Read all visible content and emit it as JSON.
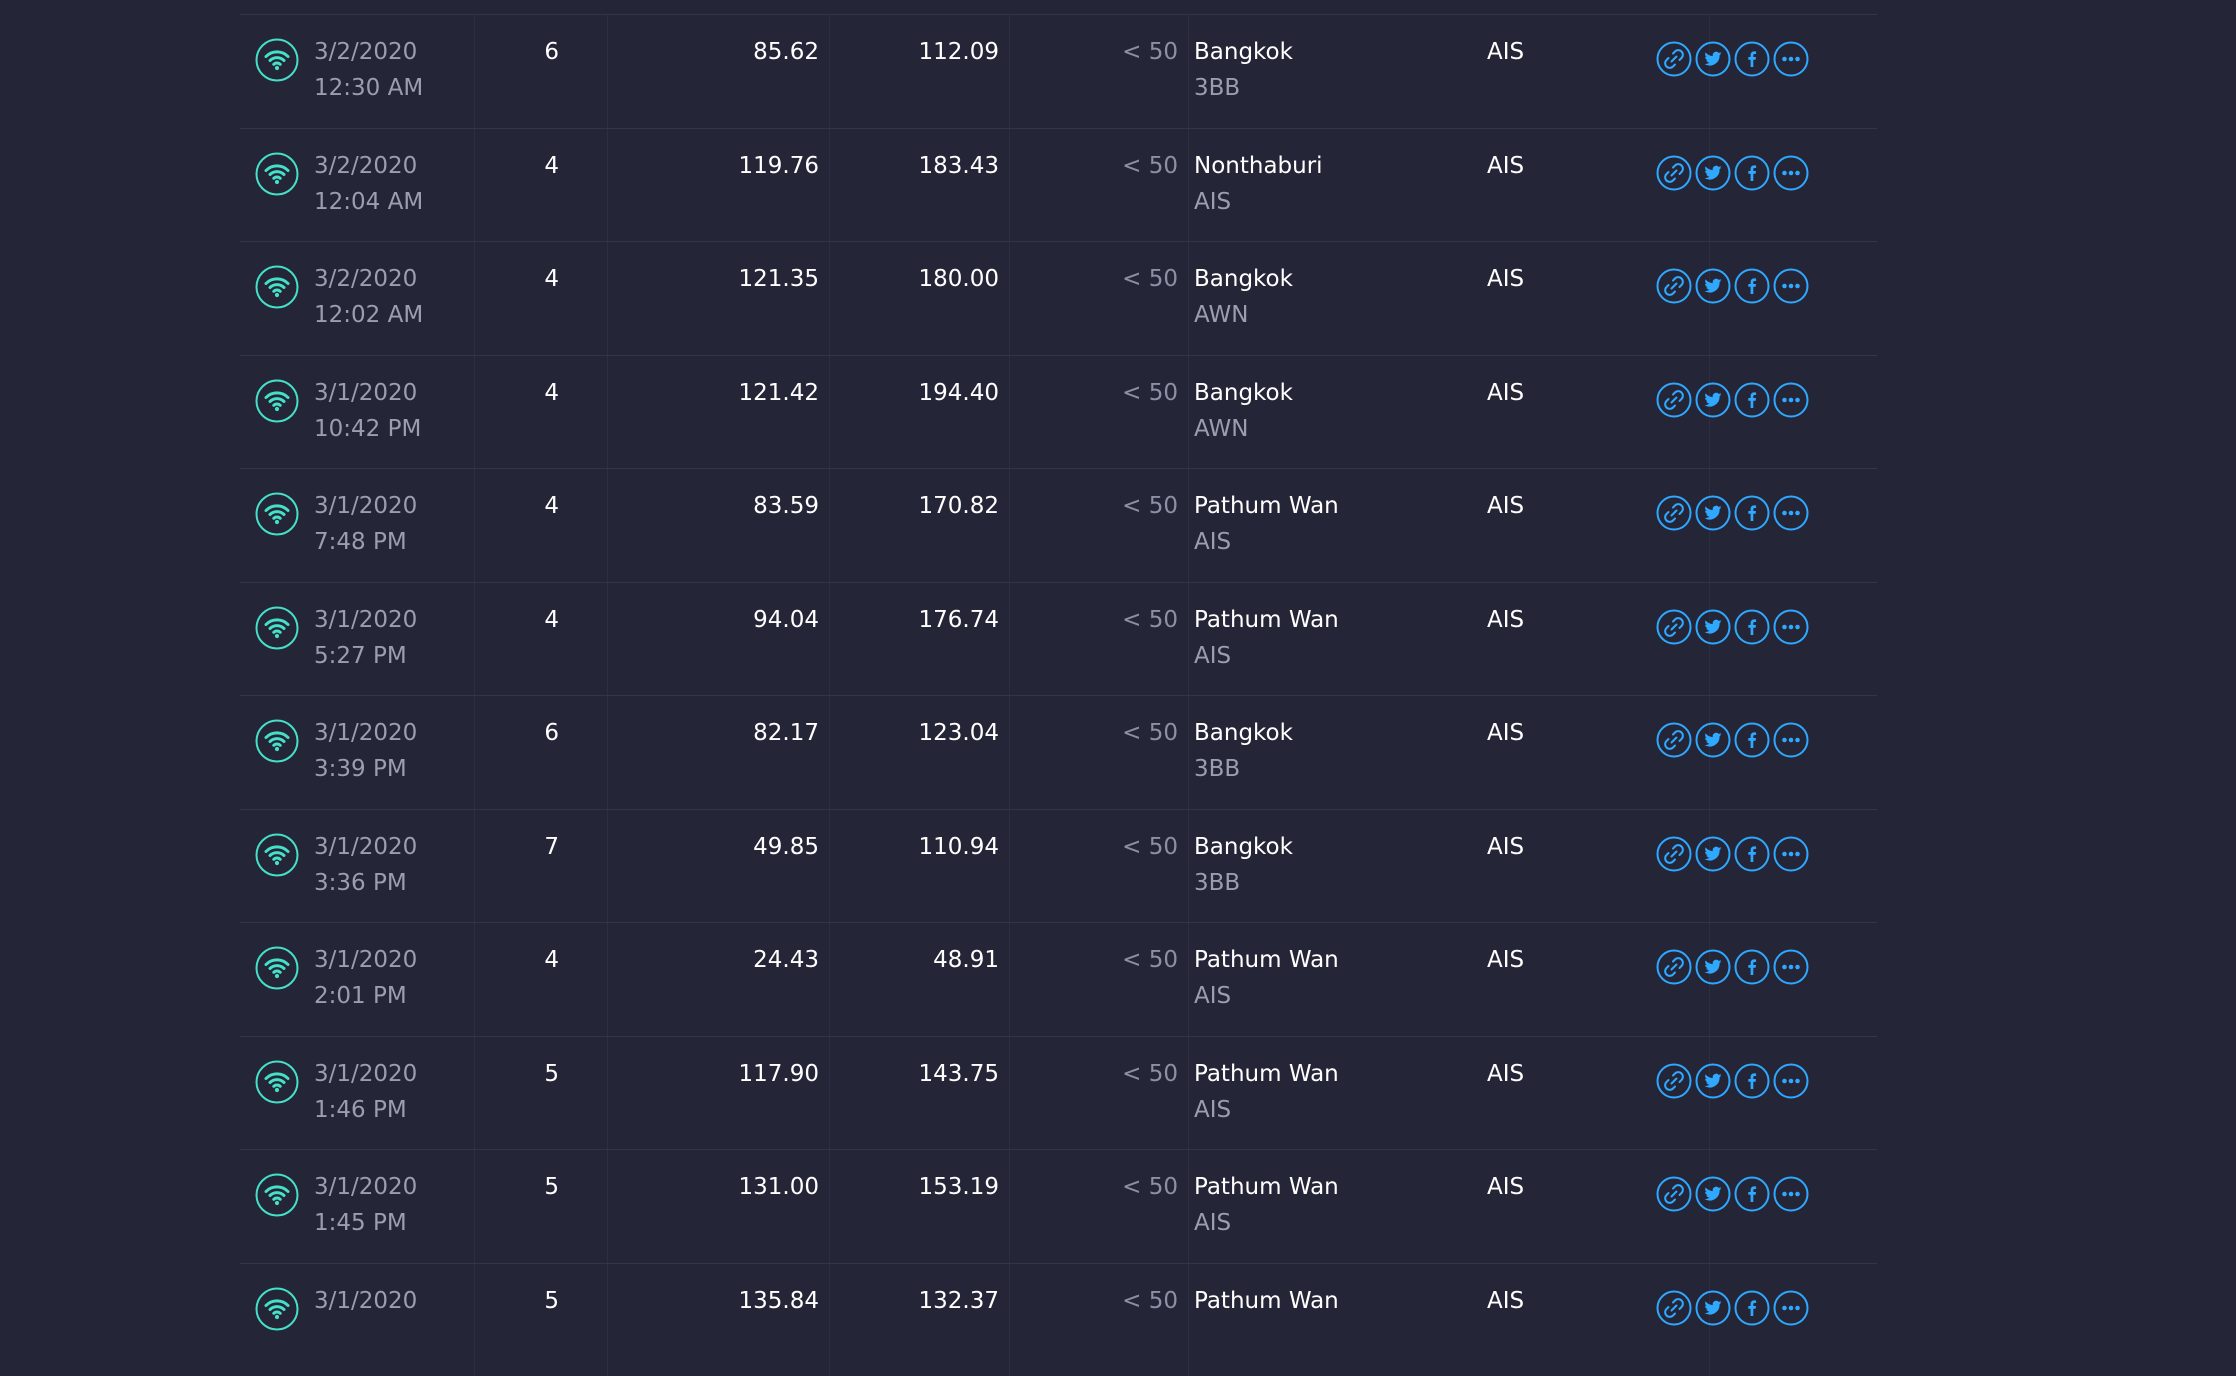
{
  "results": {
    "rows": [
      {
        "date": "3/2/2020",
        "time": "12:30 AM",
        "connections": "6",
        "download": "85.62",
        "upload": "112.09",
        "ping": "< 50",
        "location": "Bangkok",
        "server": "3BB",
        "provider": "AIS"
      },
      {
        "date": "3/2/2020",
        "time": "12:04 AM",
        "connections": "4",
        "download": "119.76",
        "upload": "183.43",
        "ping": "< 50",
        "location": "Nonthaburi",
        "server": "AIS",
        "provider": "AIS"
      },
      {
        "date": "3/2/2020",
        "time": "12:02 AM",
        "connections": "4",
        "download": "121.35",
        "upload": "180.00",
        "ping": "< 50",
        "location": "Bangkok",
        "server": "AWN",
        "provider": "AIS"
      },
      {
        "date": "3/1/2020",
        "time": "10:42 PM",
        "connections": "4",
        "download": "121.42",
        "upload": "194.40",
        "ping": "< 50",
        "location": "Bangkok",
        "server": "AWN",
        "provider": "AIS"
      },
      {
        "date": "3/1/2020",
        "time": "7:48 PM",
        "connections": "4",
        "download": "83.59",
        "upload": "170.82",
        "ping": "< 50",
        "location": "Pathum Wan",
        "server": "AIS",
        "provider": "AIS"
      },
      {
        "date": "3/1/2020",
        "time": "5:27 PM",
        "connections": "4",
        "download": "94.04",
        "upload": "176.74",
        "ping": "< 50",
        "location": "Pathum Wan",
        "server": "AIS",
        "provider": "AIS"
      },
      {
        "date": "3/1/2020",
        "time": "3:39 PM",
        "connections": "6",
        "download": "82.17",
        "upload": "123.04",
        "ping": "< 50",
        "location": "Bangkok",
        "server": "3BB",
        "provider": "AIS"
      },
      {
        "date": "3/1/2020",
        "time": "3:36 PM",
        "connections": "7",
        "download": "49.85",
        "upload": "110.94",
        "ping": "< 50",
        "location": "Bangkok",
        "server": "3BB",
        "provider": "AIS"
      },
      {
        "date": "3/1/2020",
        "time": "2:01 PM",
        "connections": "4",
        "download": "24.43",
        "upload": "48.91",
        "ping": "< 50",
        "location": "Pathum Wan",
        "server": "AIS",
        "provider": "AIS"
      },
      {
        "date": "3/1/2020",
        "time": "1:46 PM",
        "connections": "5",
        "download": "117.90",
        "upload": "143.75",
        "ping": "< 50",
        "location": "Pathum Wan",
        "server": "AIS",
        "provider": "AIS"
      },
      {
        "date": "3/1/2020",
        "time": "1:45 PM",
        "connections": "5",
        "download": "131.00",
        "upload": "153.19",
        "ping": "< 50",
        "location": "Pathum Wan",
        "server": "AIS",
        "provider": "AIS"
      },
      {
        "date": "3/1/2020",
        "time": "",
        "connections": "5",
        "download": "135.84",
        "upload": "132.37",
        "ping": "< 50",
        "location": "Pathum Wan",
        "server": "",
        "provider": "AIS"
      }
    ]
  },
  "icons": {
    "row_type": "wifi-icon",
    "share": [
      "link-icon",
      "twitter-icon",
      "facebook-icon",
      "more-icon"
    ]
  },
  "colors": {
    "background": "#252538",
    "wifi_accent": "#45e0c8",
    "share_accent": "#2fa8ff",
    "divider": "#34344a"
  }
}
